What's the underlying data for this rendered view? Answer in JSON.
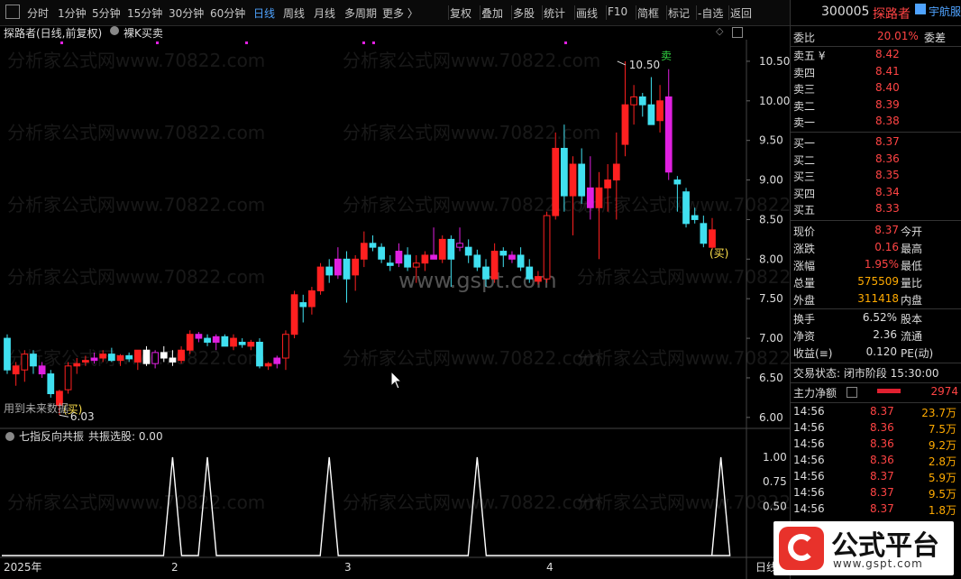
{
  "toolbar": {
    "periods": [
      "分时",
      "1分钟",
      "5分钟",
      "15分钟",
      "30分钟",
      "60分钟",
      "日线",
      "周线",
      "月线",
      "多周期",
      "更多 〉"
    ],
    "active_period": "日线",
    "tools": [
      "复权",
      "叠加",
      "多股",
      "统计",
      "画线",
      "F10",
      "简框",
      "标记",
      "-自选",
      "返回"
    ]
  },
  "chart": {
    "stock_label": "探路者(日线,前复权)",
    "indicator_name": "裸K买卖",
    "high_label": "10.50",
    "low_label": "6.03",
    "sell_mark": "卖",
    "buy_mark": "(买)",
    "future_data_note": "用到未来数据",
    "watermark_site": "www.gspt.com",
    "watermark_text": "分析家公式网www.70822.com",
    "y_labels": [
      "10.50",
      "10.00",
      "9.50",
      "9.00",
      "8.50",
      "8.00",
      "7.50",
      "7.00",
      "6.50",
      "6.00"
    ],
    "sub_indicator_title": "七指反向共振",
    "sub_indicator_value": "共振选股: 0.00",
    "sub_y_labels": [
      "1.00",
      "0.75",
      "0.50"
    ],
    "x_labels": [
      "2025年",
      "2",
      "3",
      "4"
    ],
    "x_axis_right": "日线"
  },
  "chart_data": {
    "type": "candlestick",
    "y_range": [
      5.85,
      10.75
    ],
    "candles": [
      {
        "o": 7.0,
        "h": 7.05,
        "l": 6.55,
        "c": 6.6
      },
      {
        "o": 6.55,
        "h": 6.7,
        "l": 6.4,
        "c": 6.65
      },
      {
        "o": 6.6,
        "h": 6.85,
        "l": 6.45,
        "c": 6.8
      },
      {
        "o": 6.8,
        "h": 6.85,
        "l": 6.55,
        "c": 6.65
      },
      {
        "o": 6.65,
        "h": 6.7,
        "l": 6.5,
        "c": 6.55
      },
      {
        "o": 6.55,
        "h": 6.6,
        "l": 6.25,
        "c": 6.3
      },
      {
        "o": 6.15,
        "h": 6.35,
        "l": 6.03,
        "c": 6.33
      },
      {
        "o": 6.35,
        "h": 6.7,
        "l": 6.3,
        "c": 6.65
      },
      {
        "o": 6.65,
        "h": 6.75,
        "l": 6.55,
        "c": 6.68
      },
      {
        "o": 6.7,
        "h": 6.78,
        "l": 6.65,
        "c": 6.72
      },
      {
        "o": 6.72,
        "h": 6.82,
        "l": 6.68,
        "c": 6.75
      },
      {
        "o": 6.75,
        "h": 6.85,
        "l": 6.7,
        "c": 6.8
      },
      {
        "o": 6.8,
        "h": 6.88,
        "l": 6.7,
        "c": 6.72
      },
      {
        "o": 6.72,
        "h": 6.8,
        "l": 6.65,
        "c": 6.78
      },
      {
        "o": 6.78,
        "h": 6.82,
        "l": 6.7,
        "c": 6.74
      },
      {
        "o": 6.7,
        "h": 6.85,
        "l": 6.6,
        "c": 6.85
      },
      {
        "o": 6.85,
        "h": 6.9,
        "l": 6.65,
        "c": 6.68
      },
      {
        "o": 6.68,
        "h": 6.85,
        "l": 6.62,
        "c": 6.82
      },
      {
        "o": 6.82,
        "h": 6.9,
        "l": 6.7,
        "c": 6.75
      },
      {
        "o": 6.75,
        "h": 6.85,
        "l": 6.65,
        "c": 6.7
      },
      {
        "o": 6.72,
        "h": 6.9,
        "l": 6.68,
        "c": 6.85
      },
      {
        "o": 6.85,
        "h": 7.1,
        "l": 6.8,
        "c": 7.05
      },
      {
        "o": 7.05,
        "h": 7.08,
        "l": 6.95,
        "c": 7.0
      },
      {
        "o": 7.0,
        "h": 7.05,
        "l": 6.9,
        "c": 6.95
      },
      {
        "o": 6.95,
        "h": 7.05,
        "l": 6.85,
        "c": 7.02
      },
      {
        "o": 7.02,
        "h": 7.05,
        "l": 6.9,
        "c": 6.9
      },
      {
        "o": 6.9,
        "h": 7.05,
        "l": 6.85,
        "c": 7.0
      },
      {
        "o": 6.95,
        "h": 7.0,
        "l": 6.88,
        "c": 6.92
      },
      {
        "o": 6.9,
        "h": 6.98,
        "l": 6.85,
        "c": 6.95
      },
      {
        "o": 6.95,
        "h": 7.0,
        "l": 6.62,
        "c": 6.65
      },
      {
        "o": 6.65,
        "h": 6.7,
        "l": 6.6,
        "c": 6.68
      },
      {
        "o": 6.68,
        "h": 6.78,
        "l": 6.62,
        "c": 6.75
      },
      {
        "o": 6.75,
        "h": 7.1,
        "l": 6.6,
        "c": 7.05
      },
      {
        "o": 7.05,
        "h": 7.6,
        "l": 7.0,
        "c": 7.55
      },
      {
        "o": 7.45,
        "h": 7.55,
        "l": 7.2,
        "c": 7.4
      },
      {
        "o": 7.4,
        "h": 7.65,
        "l": 7.3,
        "c": 7.6
      },
      {
        "o": 7.6,
        "h": 7.95,
        "l": 7.55,
        "c": 7.9
      },
      {
        "o": 7.9,
        "h": 8.0,
        "l": 7.7,
        "c": 7.8
      },
      {
        "o": 7.8,
        "h": 8.15,
        "l": 7.75,
        "c": 8.0
      },
      {
        "o": 8.0,
        "h": 8.1,
        "l": 7.45,
        "c": 7.75
      },
      {
        "o": 7.8,
        "h": 8.05,
        "l": 7.6,
        "c": 8.0
      },
      {
        "o": 8.0,
        "h": 8.35,
        "l": 7.9,
        "c": 8.2
      },
      {
        "o": 8.2,
        "h": 8.3,
        "l": 8.1,
        "c": 8.15
      },
      {
        "o": 8.15,
        "h": 8.2,
        "l": 7.95,
        "c": 8.0
      },
      {
        "o": 7.95,
        "h": 8.05,
        "l": 7.85,
        "c": 7.92
      },
      {
        "o": 7.95,
        "h": 8.2,
        "l": 7.9,
        "c": 8.1
      },
      {
        "o": 8.05,
        "h": 8.15,
        "l": 7.85,
        "c": 7.9
      },
      {
        "o": 7.9,
        "h": 8.05,
        "l": 7.7,
        "c": 7.95
      },
      {
        "o": 7.95,
        "h": 8.1,
        "l": 7.85,
        "c": 8.05
      },
      {
        "o": 8.05,
        "h": 8.4,
        "l": 8.0,
        "c": 8.0
      },
      {
        "o": 8.0,
        "h": 8.3,
        "l": 7.95,
        "c": 8.25
      },
      {
        "o": 8.25,
        "h": 8.3,
        "l": 7.65,
        "c": 8.0
      },
      {
        "o": 8.15,
        "h": 8.4,
        "l": 8.1,
        "c": 8.2
      },
      {
        "o": 8.15,
        "h": 8.25,
        "l": 7.95,
        "c": 8.05
      },
      {
        "o": 8.05,
        "h": 8.12,
        "l": 7.85,
        "c": 7.9
      },
      {
        "o": 7.9,
        "h": 8.0,
        "l": 7.65,
        "c": 7.75
      },
      {
        "o": 7.75,
        "h": 8.2,
        "l": 7.7,
        "c": 8.1
      },
      {
        "o": 8.1,
        "h": 8.15,
        "l": 7.9,
        "c": 8.05
      },
      {
        "o": 8.05,
        "h": 8.1,
        "l": 7.95,
        "c": 8.0
      },
      {
        "o": 8.05,
        "h": 8.15,
        "l": 7.85,
        "c": 7.9
      },
      {
        "o": 7.9,
        "h": 8.0,
        "l": 7.7,
        "c": 7.75
      },
      {
        "o": 7.72,
        "h": 7.85,
        "l": 7.68,
        "c": 7.78
      },
      {
        "o": 7.75,
        "h": 8.6,
        "l": 7.7,
        "c": 8.55
      },
      {
        "o": 8.55,
        "h": 9.6,
        "l": 8.5,
        "c": 9.4
      },
      {
        "o": 9.4,
        "h": 9.7,
        "l": 8.6,
        "c": 8.8
      },
      {
        "o": 8.8,
        "h": 9.3,
        "l": 8.3,
        "c": 9.2
      },
      {
        "o": 9.2,
        "h": 9.4,
        "l": 8.7,
        "c": 8.8
      },
      {
        "o": 8.9,
        "h": 9.3,
        "l": 8.5,
        "c": 8.65
      },
      {
        "o": 8.65,
        "h": 9.1,
        "l": 8.0,
        "c": 8.9
      },
      {
        "o": 8.9,
        "h": 9.2,
        "l": 8.6,
        "c": 9.0
      },
      {
        "o": 9.0,
        "h": 9.6,
        "l": 8.5,
        "c": 9.2
      },
      {
        "o": 9.45,
        "h": 10.5,
        "l": 9.3,
        "c": 9.95
      },
      {
        "o": 9.95,
        "h": 10.2,
        "l": 9.7,
        "c": 10.05
      },
      {
        "o": 10.05,
        "h": 10.1,
        "l": 9.8,
        "c": 9.95
      },
      {
        "o": 9.95,
        "h": 10.3,
        "l": 9.7,
        "c": 9.7
      },
      {
        "o": 9.75,
        "h": 10.2,
        "l": 9.6,
        "c": 10.0
      },
      {
        "o": 10.05,
        "h": 10.4,
        "l": 9.0,
        "c": 9.1
      },
      {
        "o": 9.0,
        "h": 9.05,
        "l": 8.6,
        "c": 8.95
      },
      {
        "o": 8.85,
        "h": 8.9,
        "l": 8.4,
        "c": 8.45
      },
      {
        "o": 8.55,
        "h": 8.65,
        "l": 8.45,
        "c": 8.5
      },
      {
        "o": 8.45,
        "h": 8.55,
        "l": 8.15,
        "c": 8.2
      },
      {
        "o": 8.15,
        "h": 8.52,
        "l": 8.12,
        "c": 8.37
      }
    ],
    "signal_peaks": [
      19,
      23,
      37,
      54,
      82
    ],
    "sub_y_range": [
      0,
      1.1
    ]
  },
  "right_panel": {
    "code": "300005",
    "name": "探路者",
    "nav": "宇航服",
    "weibi_label": "委比",
    "weibi_value": "20.01%",
    "weicha_label": "委差",
    "sell_levels": [
      {
        "label": "卖五 ¥",
        "price": "8.42"
      },
      {
        "label": "卖四",
        "price": "8.41"
      },
      {
        "label": "卖三",
        "price": "8.40"
      },
      {
        "label": "卖二",
        "price": "8.39"
      },
      {
        "label": "卖一",
        "price": "8.38"
      }
    ],
    "buy_levels": [
      {
        "label": "买一",
        "price": "8.37"
      },
      {
        "label": "买二",
        "price": "8.36"
      },
      {
        "label": "买三",
        "price": "8.35"
      },
      {
        "label": "买四",
        "price": "8.34"
      },
      {
        "label": "买五",
        "price": "8.33"
      }
    ],
    "stats": [
      {
        "l1": "现价",
        "v1": "8.37",
        "l2": "今开"
      },
      {
        "l1": "涨跌",
        "v1": "0.16",
        "l2": "最高"
      },
      {
        "l1": "涨幅",
        "v1": "1.95%",
        "l2": "最低"
      },
      {
        "l1": "总量",
        "v1": "575509",
        "l2": "量比"
      },
      {
        "l1": "外盘",
        "v1": "311418",
        "l2": "内盘"
      }
    ],
    "stats2": [
      {
        "l1": "换手",
        "v1": "6.52%",
        "l2": "股本"
      },
      {
        "l1": "净资",
        "v1": "2.36",
        "l2": "流通"
      },
      {
        "l1": "收益(≡)",
        "v1": "0.120",
        "l2": "PE(动)"
      }
    ],
    "trade_status": "交易状态: 闭市阶段 15:30:00",
    "main_net_label": "主力净额",
    "main_net_value": "2974",
    "ticks": [
      {
        "t": "14:56",
        "p": "8.37",
        "v": "23.7万"
      },
      {
        "t": "14:56",
        "p": "8.36",
        "v": "7.5万"
      },
      {
        "t": "14:56",
        "p": "8.36",
        "v": "9.2万"
      },
      {
        "t": "14:56",
        "p": "8.36",
        "v": "2.8万"
      },
      {
        "t": "14:56",
        "p": "8.37",
        "v": "5.9万"
      },
      {
        "t": "14:56",
        "p": "8.37",
        "v": "9.5万"
      },
      {
        "t": "14:56",
        "p": "8.37",
        "v": "1.8万"
      }
    ],
    "logo_text": "公式平台",
    "logo_url": "www.gspt.com"
  },
  "colors": {
    "up": "#ff2020",
    "down": "#40e0f0",
    "purple": "#e020e0",
    "flat": "#ffffff",
    "blue": "#4fa3ff",
    "yellow": "#ffe14d"
  }
}
